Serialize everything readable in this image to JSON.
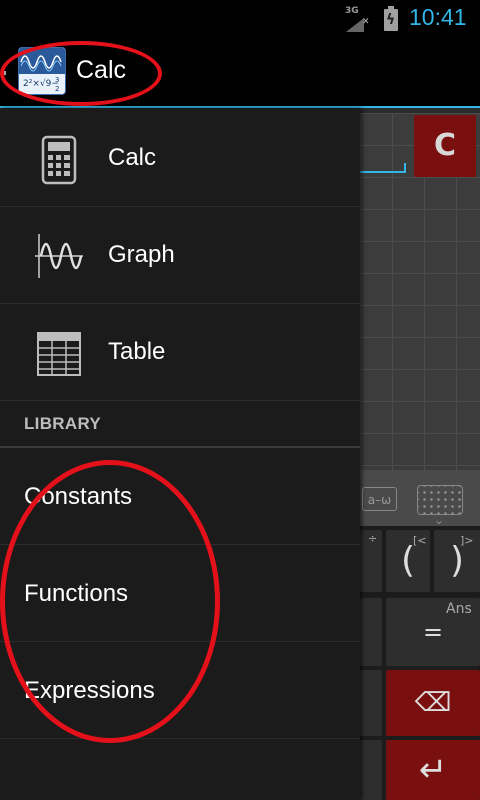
{
  "status_bar": {
    "network": "3G",
    "time": "10:41"
  },
  "action_bar": {
    "title": "Calc",
    "icon": "calculator-app-icon"
  },
  "drawer": {
    "nav_items": [
      {
        "label": "Calc",
        "icon": "calculator-icon"
      },
      {
        "label": "Graph",
        "icon": "graph-wave-icon"
      },
      {
        "label": "Table",
        "icon": "table-grid-icon"
      }
    ],
    "section_title": "LIBRARY",
    "library_items": [
      {
        "label": "Constants"
      },
      {
        "label": "Functions"
      },
      {
        "label": "Expressions"
      }
    ]
  },
  "background_app": {
    "clear_key": "C",
    "ans_label": "Ans",
    "equals_key": "=",
    "open_paren": "(",
    "close_paren": ")",
    "divide_sup": "÷",
    "bracket_open_sup": "[<",
    "bracket_close_sup": "]>"
  },
  "annotations": {
    "color": "#e4101a"
  }
}
